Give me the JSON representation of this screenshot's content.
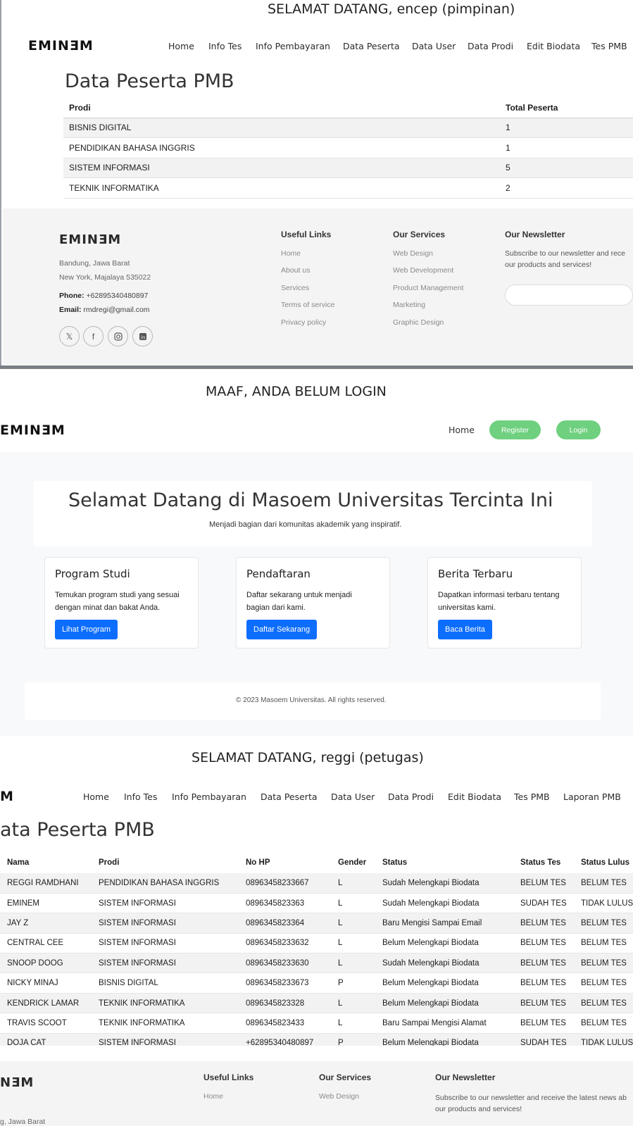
{
  "s1": {
    "welcome": "SELAMAT DATANG, encep (pimpinan)",
    "logo": "EMINƎM",
    "nav": [
      "Home",
      "Info Tes",
      "Info Pembayaran",
      "Data Peserta",
      "Data User",
      "Data Prodi",
      "Edit Biodata",
      "Tes PMB"
    ],
    "title": "Data Peserta PMB",
    "table": {
      "headers": [
        "Prodi",
        "Total Peserta"
      ],
      "rows": [
        [
          "BISNIS DIGITAL",
          "1"
        ],
        [
          "PENDIDIKAN BAHASA INGGRIS",
          "1"
        ],
        [
          "SISTEM INFORMASI",
          "5"
        ],
        [
          "TEKNIK INFORMATIKA",
          "2"
        ]
      ]
    },
    "footer": {
      "logo": "EMINƎM",
      "address1": "Bandung, Jawa Barat",
      "address2": "New York, Majalaya 535022",
      "phone_label": "Phone:",
      "phone": " +628953404808­97",
      "email_label": "Email:",
      "email": " rmdregi@gmail.com",
      "useful_links_title": "Useful Links",
      "useful_links": [
        "Home",
        "About us",
        "Services",
        "Terms of service",
        "Privacy policy"
      ],
      "services_title": "Our Services",
      "services": [
        "Web Design",
        "Web Development",
        "Product Management",
        "Marketing",
        "Graphic Design"
      ],
      "newsletter_title": "Our Newsletter",
      "newsletter_text1": "Subscribe to our newsletter and rece",
      "newsletter_text2": "our products and services!",
      "social_icons": [
        "x-icon",
        "facebook-icon",
        "instagram-icon",
        "linkedin-icon"
      ]
    }
  },
  "s2": {
    "notice": "MAAF, ANDA BELUM LOGIN",
    "logo": "EMINƎM",
    "nav_home": "Home",
    "register": "Register",
    "login": "Login",
    "hero_title": "Selamat Datang di Masoem Universitas Tercinta Ini",
    "hero_sub": "Menjadi bagian dari komunitas akademik yang inspiratif.",
    "cards": [
      {
        "title": "Program Studi",
        "text1": "Temukan program studi yang sesuai",
        "text2": "dengan minat dan bakat Anda.",
        "button": "Lihat Program"
      },
      {
        "title": "Pendaftaran",
        "text1": "Daftar sekarang untuk menjadi",
        "text2": "bagian dari kami.",
        "button": "Daftar Sekarang"
      },
      {
        "title": "Berita Terbaru",
        "text1": "Dapatkan informasi terbaru tentang",
        "text2": "universitas kami.",
        "button": "Baca Berita"
      }
    ],
    "copyright": "© 2023 Masoem Universitas. All rights reserved.",
    "colors": {
      "pill": "#6fd07f",
      "button": "#0d6efd"
    }
  },
  "s3": {
    "welcome": "SELAMAT DATANG, reggi (petugas)",
    "logo": "M",
    "nav": [
      "Home",
      "Info Tes",
      "Info Pembayaran",
      "Data Peserta",
      "Data User",
      "Data Prodi",
      "Edit Biodata",
      "Tes PMB",
      "Laporan PMB"
    ],
    "title": "ata Peserta PMB",
    "table": {
      "headers": [
        "Nama",
        "Prodi",
        "No HP",
        "Gender",
        "Status",
        "Status Tes",
        "Status Lulus"
      ],
      "rows": [
        [
          "REGGI RAMDHANI",
          "PENDIDIKAN BAHASA INGGRIS",
          "08963458233667",
          "L",
          "Sudah Melengkapi Biodata",
          "BELUM TES",
          "BELUM TES"
        ],
        [
          "EMINEM",
          "SISTEM INFORMASI",
          "0896345823363",
          "L",
          "Sudah Melengkapi Biodata",
          "SUDAH TES",
          "TIDAK LULUS"
        ],
        [
          "JAY Z",
          "SISTEM INFORMASI",
          "0896345823364",
          "L",
          "Baru Mengisi Sampai Email",
          "BELUM TES",
          "BELUM TES"
        ],
        [
          "CENTRAL CEE",
          "SISTEM INFORMASI",
          "08963458233632",
          "L",
          "Belum Melengkapi Biodata",
          "BELUM TES",
          "BELUM TES"
        ],
        [
          "SNOOP DOOG",
          "SISTEM INFORMASI",
          "08963458233630",
          "L",
          "Sudah Melengkapi Biodata",
          "BELUM TES",
          "BELUM TES"
        ],
        [
          "NICKY MINAJ",
          "BISNIS DIGITAL",
          "08963458233673",
          "P",
          "Belum Melengkapi Biodata",
          "BELUM TES",
          "BELUM TES"
        ],
        [
          "KENDRICK LAMAR",
          "TEKNIK INFORMATIKA",
          "0896345823328",
          "L",
          "Belum Melengkapi Biodata",
          "BELUM TES",
          "BELUM TES"
        ],
        [
          "TRAVIS SCOOT",
          "TEKNIK INFORMATIKA",
          "0896345823433",
          "L",
          "Baru Sampai Mengisi Alamat",
          "BELUM TES",
          "BELUM TES"
        ],
        [
          "DOJA CAT",
          "SISTEM INFORMASI",
          "+62895340480897",
          "P",
          "Belum Melengkapi Biodata",
          "SUDAH TES",
          "TIDAK LULUS"
        ]
      ]
    },
    "footer": {
      "logo": "NƎM",
      "address1": "g, Jawa Barat",
      "useful_links_title": "Useful Links",
      "useful_first": "Home",
      "services_title": "Our Services",
      "services_first": "Web Design",
      "newsletter_title": "Our Newsletter",
      "newsletter_text1": "Subscribe to our newsletter and receive the latest news ab",
      "newsletter_text2": "our products and services!"
    }
  }
}
